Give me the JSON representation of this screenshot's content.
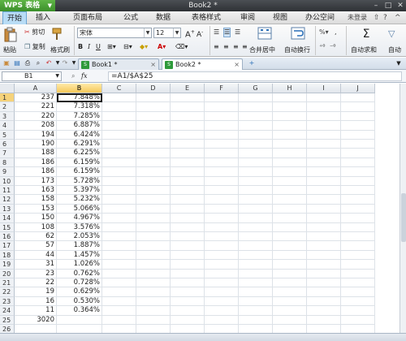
{
  "titlebar": {
    "app_name": "WPS 表格",
    "doc_title": "Book2 *"
  },
  "menu": {
    "items": [
      "开始",
      "插入",
      "页面布局",
      "公式",
      "数据",
      "表格样式",
      "审阅",
      "视图",
      "办公空间"
    ],
    "active_index": 0,
    "login_label": "未登录"
  },
  "ribbon": {
    "paste_label": "粘贴",
    "cut_label": "剪切",
    "copy_label": "复制",
    "format_painter_label": "格式刷",
    "font_name": "宋体",
    "font_size": "12",
    "merge_center_label": "合并居中",
    "wrap_text_label": "自动换行",
    "autosum_label": "自动求和",
    "autofilter_label": "自动"
  },
  "tabs": [
    {
      "label": "Book1 *",
      "active": false
    },
    {
      "label": "Book2 *",
      "active": true
    }
  ],
  "formula_bar": {
    "cell_ref": "B1",
    "fx_label": "fx",
    "formula": "=A1/$A$25"
  },
  "grid": {
    "columns": [
      "A",
      "B",
      "C",
      "D",
      "E",
      "F",
      "G",
      "H",
      "I",
      "J"
    ],
    "selected_column": "B",
    "selected_row": 1,
    "rows": [
      {
        "n": "1",
        "a": "237",
        "b": "7.848%"
      },
      {
        "n": "2",
        "a": "221",
        "b": "7.318%"
      },
      {
        "n": "3",
        "a": "220",
        "b": "7.285%"
      },
      {
        "n": "4",
        "a": "208",
        "b": "6.887%"
      },
      {
        "n": "5",
        "a": "194",
        "b": "6.424%"
      },
      {
        "n": "6",
        "a": "190",
        "b": "6.291%"
      },
      {
        "n": "7",
        "a": "188",
        "b": "6.225%"
      },
      {
        "n": "8",
        "a": "186",
        "b": "6.159%"
      },
      {
        "n": "9",
        "a": "186",
        "b": "6.159%"
      },
      {
        "n": "10",
        "a": "173",
        "b": "5.728%"
      },
      {
        "n": "11",
        "a": "163",
        "b": "5.397%"
      },
      {
        "n": "12",
        "a": "158",
        "b": "5.232%"
      },
      {
        "n": "13",
        "a": "153",
        "b": "5.066%"
      },
      {
        "n": "14",
        "a": "150",
        "b": "4.967%"
      },
      {
        "n": "15",
        "a": "108",
        "b": "3.576%"
      },
      {
        "n": "16",
        "a": "62",
        "b": "2.053%"
      },
      {
        "n": "17",
        "a": "57",
        "b": "1.887%"
      },
      {
        "n": "18",
        "a": "44",
        "b": "1.457%"
      },
      {
        "n": "19",
        "a": "31",
        "b": "1.026%"
      },
      {
        "n": "20",
        "a": "23",
        "b": "0.762%"
      },
      {
        "n": "21",
        "a": "22",
        "b": "0.728%"
      },
      {
        "n": "22",
        "a": "19",
        "b": "0.629%"
      },
      {
        "n": "23",
        "a": "16",
        "b": "0.530%"
      },
      {
        "n": "24",
        "a": "11",
        "b": "0.364%"
      },
      {
        "n": "25",
        "a": "3020",
        "b": ""
      },
      {
        "n": "26",
        "a": "",
        "b": ""
      }
    ]
  },
  "colors": {
    "app_green": "#3b8f2a",
    "selection_header": "#f5c95a",
    "ribbon_bg": "#e9edf2"
  }
}
